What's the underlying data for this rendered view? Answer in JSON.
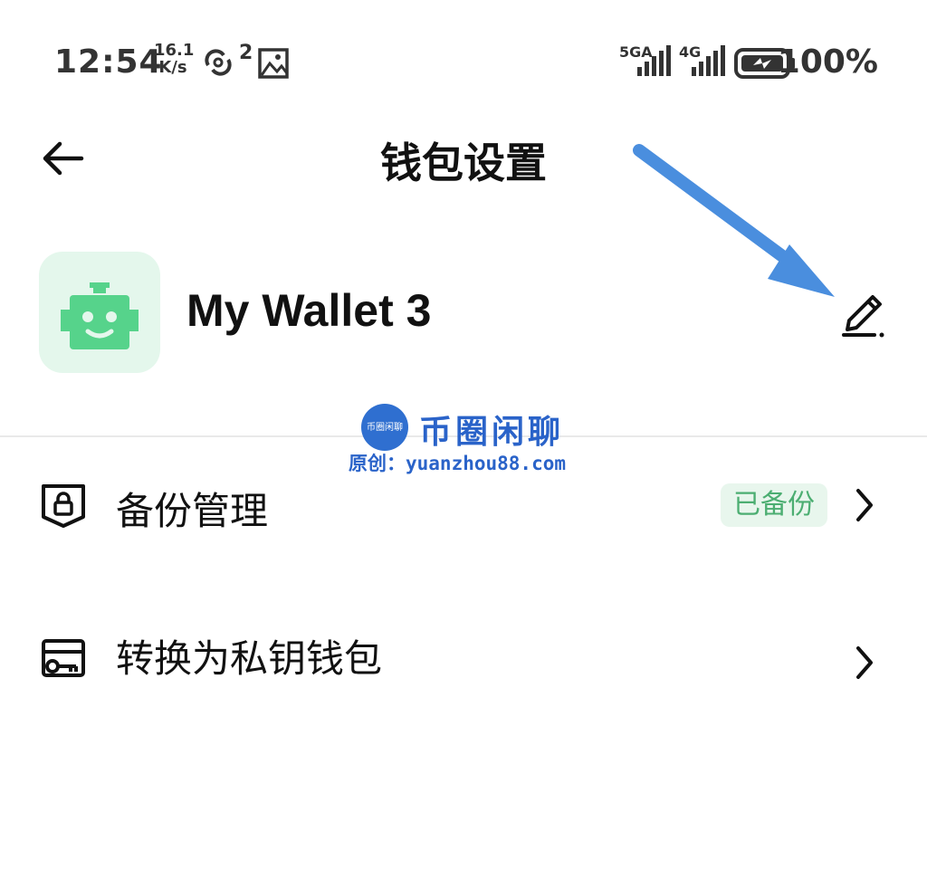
{
  "status_bar": {
    "time": "12:54",
    "net_speed_value": "16.1",
    "net_speed_unit": "K/s",
    "notification_count": "2",
    "signal_5g": "5GA",
    "signal_4g": "4G",
    "battery_percent": "100%"
  },
  "header": {
    "title": "钱包设置",
    "back_icon": "arrow-left-icon"
  },
  "wallet": {
    "name": "My Wallet 3",
    "avatar_icon": "robot-icon",
    "edit_icon": "pencil-icon"
  },
  "watermark": {
    "logo_text": "币圈闲聊",
    "name": "币圈闲聊",
    "credit": "原创：yuanzhou88.com"
  },
  "menu": [
    {
      "label": "备份管理",
      "icon": "shield-lock-icon",
      "badge": "已备份"
    },
    {
      "label": "转换为私钥钱包",
      "icon": "key-card-icon"
    }
  ],
  "colors": {
    "accent_green": "#56d38b",
    "badge_text": "#4cae72",
    "annotation_blue": "#4a8ede",
    "watermark_blue": "#2a63c9"
  }
}
